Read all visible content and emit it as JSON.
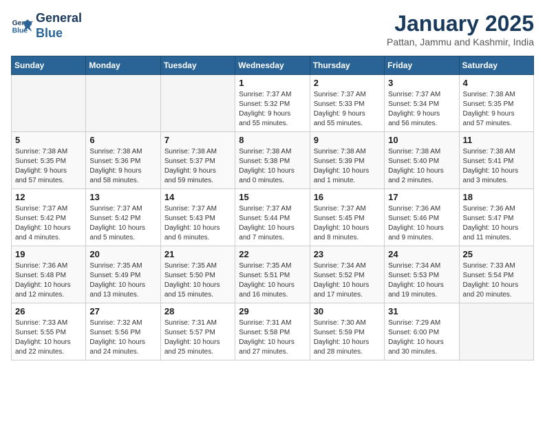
{
  "header": {
    "logo_line1": "General",
    "logo_line2": "Blue",
    "title": "January 2025",
    "location": "Pattan, Jammu and Kashmir, India"
  },
  "weekdays": [
    "Sunday",
    "Monday",
    "Tuesday",
    "Wednesday",
    "Thursday",
    "Friday",
    "Saturday"
  ],
  "weeks": [
    [
      {
        "day": "",
        "info": ""
      },
      {
        "day": "",
        "info": ""
      },
      {
        "day": "",
        "info": ""
      },
      {
        "day": "1",
        "info": "Sunrise: 7:37 AM\nSunset: 5:32 PM\nDaylight: 9 hours\nand 55 minutes."
      },
      {
        "day": "2",
        "info": "Sunrise: 7:37 AM\nSunset: 5:33 PM\nDaylight: 9 hours\nand 55 minutes."
      },
      {
        "day": "3",
        "info": "Sunrise: 7:37 AM\nSunset: 5:34 PM\nDaylight: 9 hours\nand 56 minutes."
      },
      {
        "day": "4",
        "info": "Sunrise: 7:38 AM\nSunset: 5:35 PM\nDaylight: 9 hours\nand 57 minutes."
      }
    ],
    [
      {
        "day": "5",
        "info": "Sunrise: 7:38 AM\nSunset: 5:35 PM\nDaylight: 9 hours\nand 57 minutes."
      },
      {
        "day": "6",
        "info": "Sunrise: 7:38 AM\nSunset: 5:36 PM\nDaylight: 9 hours\nand 58 minutes."
      },
      {
        "day": "7",
        "info": "Sunrise: 7:38 AM\nSunset: 5:37 PM\nDaylight: 9 hours\nand 59 minutes."
      },
      {
        "day": "8",
        "info": "Sunrise: 7:38 AM\nSunset: 5:38 PM\nDaylight: 10 hours\nand 0 minutes."
      },
      {
        "day": "9",
        "info": "Sunrise: 7:38 AM\nSunset: 5:39 PM\nDaylight: 10 hours\nand 1 minute."
      },
      {
        "day": "10",
        "info": "Sunrise: 7:38 AM\nSunset: 5:40 PM\nDaylight: 10 hours\nand 2 minutes."
      },
      {
        "day": "11",
        "info": "Sunrise: 7:38 AM\nSunset: 5:41 PM\nDaylight: 10 hours\nand 3 minutes."
      }
    ],
    [
      {
        "day": "12",
        "info": "Sunrise: 7:37 AM\nSunset: 5:42 PM\nDaylight: 10 hours\nand 4 minutes."
      },
      {
        "day": "13",
        "info": "Sunrise: 7:37 AM\nSunset: 5:42 PM\nDaylight: 10 hours\nand 5 minutes."
      },
      {
        "day": "14",
        "info": "Sunrise: 7:37 AM\nSunset: 5:43 PM\nDaylight: 10 hours\nand 6 minutes."
      },
      {
        "day": "15",
        "info": "Sunrise: 7:37 AM\nSunset: 5:44 PM\nDaylight: 10 hours\nand 7 minutes."
      },
      {
        "day": "16",
        "info": "Sunrise: 7:37 AM\nSunset: 5:45 PM\nDaylight: 10 hours\nand 8 minutes."
      },
      {
        "day": "17",
        "info": "Sunrise: 7:36 AM\nSunset: 5:46 PM\nDaylight: 10 hours\nand 9 minutes."
      },
      {
        "day": "18",
        "info": "Sunrise: 7:36 AM\nSunset: 5:47 PM\nDaylight: 10 hours\nand 11 minutes."
      }
    ],
    [
      {
        "day": "19",
        "info": "Sunrise: 7:36 AM\nSunset: 5:48 PM\nDaylight: 10 hours\nand 12 minutes."
      },
      {
        "day": "20",
        "info": "Sunrise: 7:35 AM\nSunset: 5:49 PM\nDaylight: 10 hours\nand 13 minutes."
      },
      {
        "day": "21",
        "info": "Sunrise: 7:35 AM\nSunset: 5:50 PM\nDaylight: 10 hours\nand 15 minutes."
      },
      {
        "day": "22",
        "info": "Sunrise: 7:35 AM\nSunset: 5:51 PM\nDaylight: 10 hours\nand 16 minutes."
      },
      {
        "day": "23",
        "info": "Sunrise: 7:34 AM\nSunset: 5:52 PM\nDaylight: 10 hours\nand 17 minutes."
      },
      {
        "day": "24",
        "info": "Sunrise: 7:34 AM\nSunset: 5:53 PM\nDaylight: 10 hours\nand 19 minutes."
      },
      {
        "day": "25",
        "info": "Sunrise: 7:33 AM\nSunset: 5:54 PM\nDaylight: 10 hours\nand 20 minutes."
      }
    ],
    [
      {
        "day": "26",
        "info": "Sunrise: 7:33 AM\nSunset: 5:55 PM\nDaylight: 10 hours\nand 22 minutes."
      },
      {
        "day": "27",
        "info": "Sunrise: 7:32 AM\nSunset: 5:56 PM\nDaylight: 10 hours\nand 24 minutes."
      },
      {
        "day": "28",
        "info": "Sunrise: 7:31 AM\nSunset: 5:57 PM\nDaylight: 10 hours\nand 25 minutes."
      },
      {
        "day": "29",
        "info": "Sunrise: 7:31 AM\nSunset: 5:58 PM\nDaylight: 10 hours\nand 27 minutes."
      },
      {
        "day": "30",
        "info": "Sunrise: 7:30 AM\nSunset: 5:59 PM\nDaylight: 10 hours\nand 28 minutes."
      },
      {
        "day": "31",
        "info": "Sunrise: 7:29 AM\nSunset: 6:00 PM\nDaylight: 10 hours\nand 30 minutes."
      },
      {
        "day": "",
        "info": ""
      }
    ]
  ]
}
